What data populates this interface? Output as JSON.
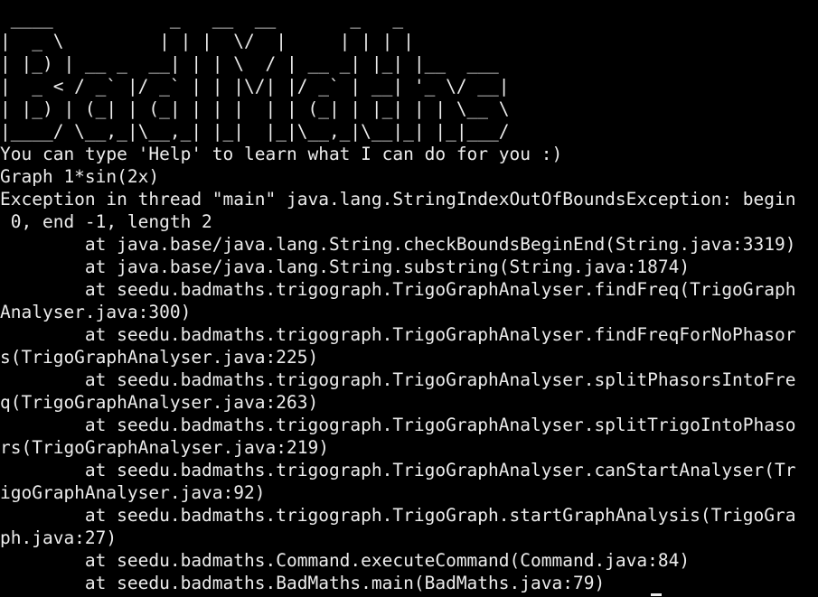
{
  "terminal": {
    "colors": {
      "background": "#000000",
      "foreground": "#ececec"
    },
    "lines": [
      " ____           _   __  __       _   _",
      "|  _ \\         | | |  \\/  |     | | | |",
      "| |_) | __ _  __| | | \\  / | __ _| |_| |__  ___",
      "|  _ < / _` |/ _` | | |\\/| |/ _` | __| '_ \\/ __|",
      "| |_) | (_| | (_| | | |  | | (_| | |_| | | \\__ \\",
      "|____/ \\__,_|\\__,_| |_|  |_|\\__,_|\\__|_| |_|___/",
      "You can type 'Help' to learn what I can do for you :)",
      "Graph 1*sin(2x)",
      "Exception in thread \"main\" java.lang.StringIndexOutOfBoundsException: begin",
      " 0, end -1, length 2",
      "        at java.base/java.lang.String.checkBoundsBeginEnd(String.java:3319)",
      "        at java.base/java.lang.String.substring(String.java:1874)",
      "        at seedu.badmaths.trigograph.TrigoGraphAnalyser.findFreq(TrigoGraph",
      "Analyser.java:300)",
      "        at seedu.badmaths.trigograph.TrigoGraphAnalyser.findFreqForNoPhasor",
      "s(TrigoGraphAnalyser.java:225)",
      "        at seedu.badmaths.trigograph.TrigoGraphAnalyser.splitPhasorsIntoFre",
      "q(TrigoGraphAnalyser.java:263)",
      "        at seedu.badmaths.trigograph.TrigoGraphAnalyser.splitTrigoIntoPhaso",
      "rs(TrigoGraphAnalyser.java:219)",
      "        at seedu.badmaths.trigograph.TrigoGraphAnalyser.canStartAnalyser(Tr",
      "igoGraphAnalyser.java:92)",
      "        at seedu.badmaths.trigograph.TrigoGraph.startGraphAnalysis(TrigoGra",
      "ph.java:27)",
      "        at seedu.badmaths.Command.executeCommand(Command.java:84)",
      "        at seedu.badmaths.BadMaths.main(BadMaths.java:79)"
    ]
  }
}
